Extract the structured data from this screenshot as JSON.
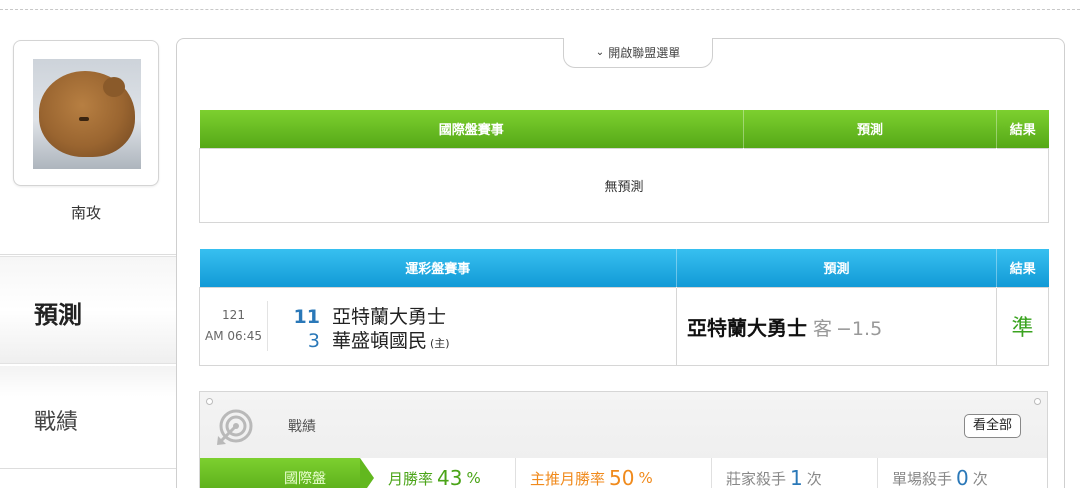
{
  "user": {
    "name": "南攻"
  },
  "nav": {
    "predict": "預測",
    "record": "戰績"
  },
  "league_toggle": {
    "label": "開啟聯盟選單"
  },
  "intl_table": {
    "headers": [
      "國際盤賽事",
      "預測",
      "結果"
    ],
    "empty_text": "無預測"
  },
  "sport_table": {
    "headers": [
      "運彩盤賽事",
      "預測",
      "結果"
    ],
    "rows": [
      {
        "game_no": "121",
        "time": "AM 06:45",
        "away": {
          "score": "11",
          "team": "亞特蘭大勇士"
        },
        "home": {
          "score": "3",
          "team": "華盛頓國民",
          "tag": "(主)"
        },
        "pick_team": "亞特蘭大勇士",
        "pick_side": "客",
        "pick_line": "−1.5",
        "result": "準"
      }
    ]
  },
  "record": {
    "title": "戰績",
    "see_all": "看全部",
    "tab": "國際盤",
    "month_rate": {
      "label": "月勝率",
      "value": "43",
      "unit": "%"
    },
    "main_rate": {
      "label": "主推月勝率",
      "value": "50",
      "unit": "%"
    },
    "banker_kills": {
      "label": "莊家殺手",
      "value": "1",
      "unit": "次"
    },
    "single_kills": {
      "label": "單場殺手",
      "value": "0",
      "unit": "次"
    }
  },
  "colors": {
    "green": "#55a817",
    "blue": "#129ad6",
    "orange": "#f08a1c",
    "result_green": "#3aa31f"
  },
  "icons": {
    "league_toggle": "chevron-down-icon",
    "record": "target-icon"
  }
}
